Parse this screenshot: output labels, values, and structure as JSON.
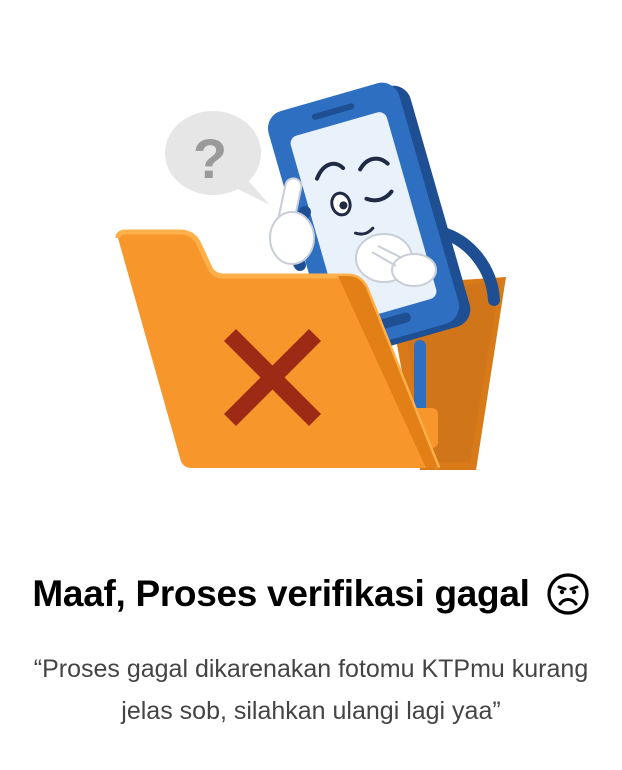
{
  "error_state": {
    "illustration": "phone-mascot-in-folder-with-x",
    "bubble_symbol": "?",
    "title": "Maaf, Proses verifikasi gagal",
    "title_icon": "sad-face-icon",
    "message": "“Proses gagal dikarenakan fotomu KTPmu kurang jelas sob, silahkan ulangi lagi yaa”"
  },
  "colors": {
    "folder": "#F7962B",
    "folder_dark": "#E27F17",
    "x_mark": "#9C2A14",
    "phone": "#2E6FC2",
    "phone_dark": "#1F4F93",
    "screen": "#E9F2FB",
    "bubble": "#E6E6E6",
    "title": "#000000",
    "message": "#444444"
  }
}
